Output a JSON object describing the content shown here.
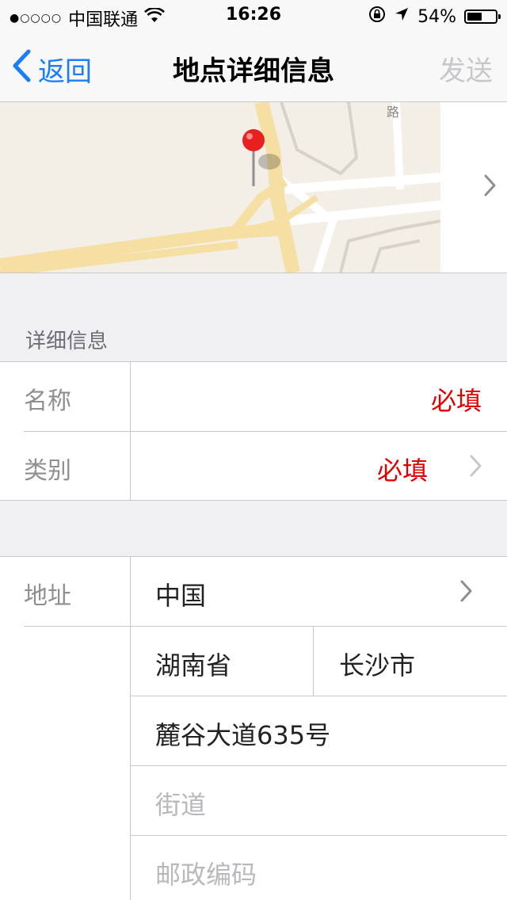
{
  "status_bar": {
    "signal": "●○○○○",
    "carrier": "中国联通",
    "time": "16:26",
    "battery": "54%",
    "battery_level": 0.54
  },
  "nav": {
    "back_label": "返回",
    "title": "地点详细信息",
    "send_label": "发送"
  },
  "map": {
    "road_label": "路"
  },
  "details": {
    "header": "详细信息",
    "name_label": "名称",
    "name_value": "必填",
    "category_label": "类别",
    "category_value": "必填"
  },
  "address": {
    "label": "地址",
    "country": "中国",
    "province": "湖南省",
    "city": "长沙市",
    "street_line": "麓谷大道635号",
    "street_placeholder": "街道",
    "postal_placeholder": "邮政编码"
  },
  "colors": {
    "accent": "#1a7efb",
    "required": "#e10000",
    "disabled": "#c7c7cc",
    "pin": "#e82020"
  }
}
